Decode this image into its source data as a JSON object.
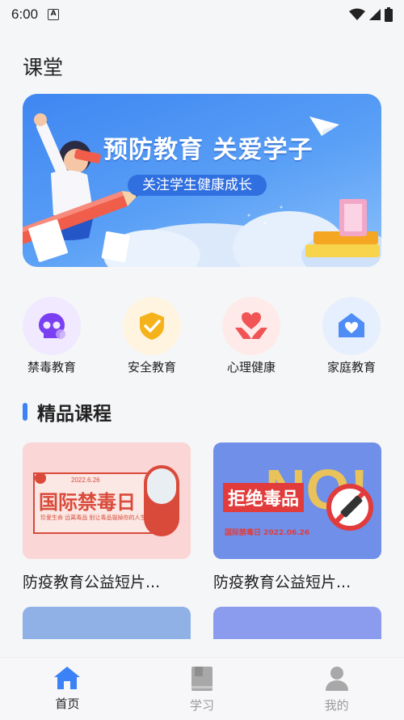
{
  "status": {
    "time": "6:00",
    "indicator": "A"
  },
  "page": {
    "title": "课堂"
  },
  "banner": {
    "headline": "预防教育 关爱学子",
    "subtitle": "关注学生健康成长"
  },
  "categories": [
    {
      "label": "禁毒教育",
      "icon": "skull-icon",
      "bg": "#f0e9ff",
      "color": "#7b3ff2"
    },
    {
      "label": "安全教育",
      "icon": "shield-check-icon",
      "bg": "#fff4e0",
      "color": "#f5b21a"
    },
    {
      "label": "心理健康",
      "icon": "heart-hands-icon",
      "bg": "#ffeaea",
      "color": "#f05454"
    },
    {
      "label": "家庭教育",
      "icon": "house-heart-icon",
      "bg": "#e6effd",
      "color": "#4f8df6"
    }
  ],
  "section": {
    "title": "精品课程"
  },
  "courses": [
    {
      "title": "防疫教育公益短片...",
      "poster_title": "国际禁毒日",
      "poster_date": "2022.6.26",
      "poster_caption": "珍爱生命 远离毒品 别让毒品毁掉你的人生"
    },
    {
      "title": "防疫教育公益短片...",
      "poster_title": "拒绝毒品",
      "poster_bg_text": "NO!",
      "poster_date": "国际禁毒日 2022.06.26"
    }
  ],
  "tabbar": {
    "items": [
      {
        "label": "首页",
        "icon": "home-icon",
        "active": true
      },
      {
        "label": "学习",
        "icon": "book-icon",
        "active": false
      },
      {
        "label": "我的",
        "icon": "person-icon",
        "active": false
      }
    ]
  },
  "colors": {
    "accent": "#3b82f6",
    "inactive": "#9a9a9a"
  }
}
